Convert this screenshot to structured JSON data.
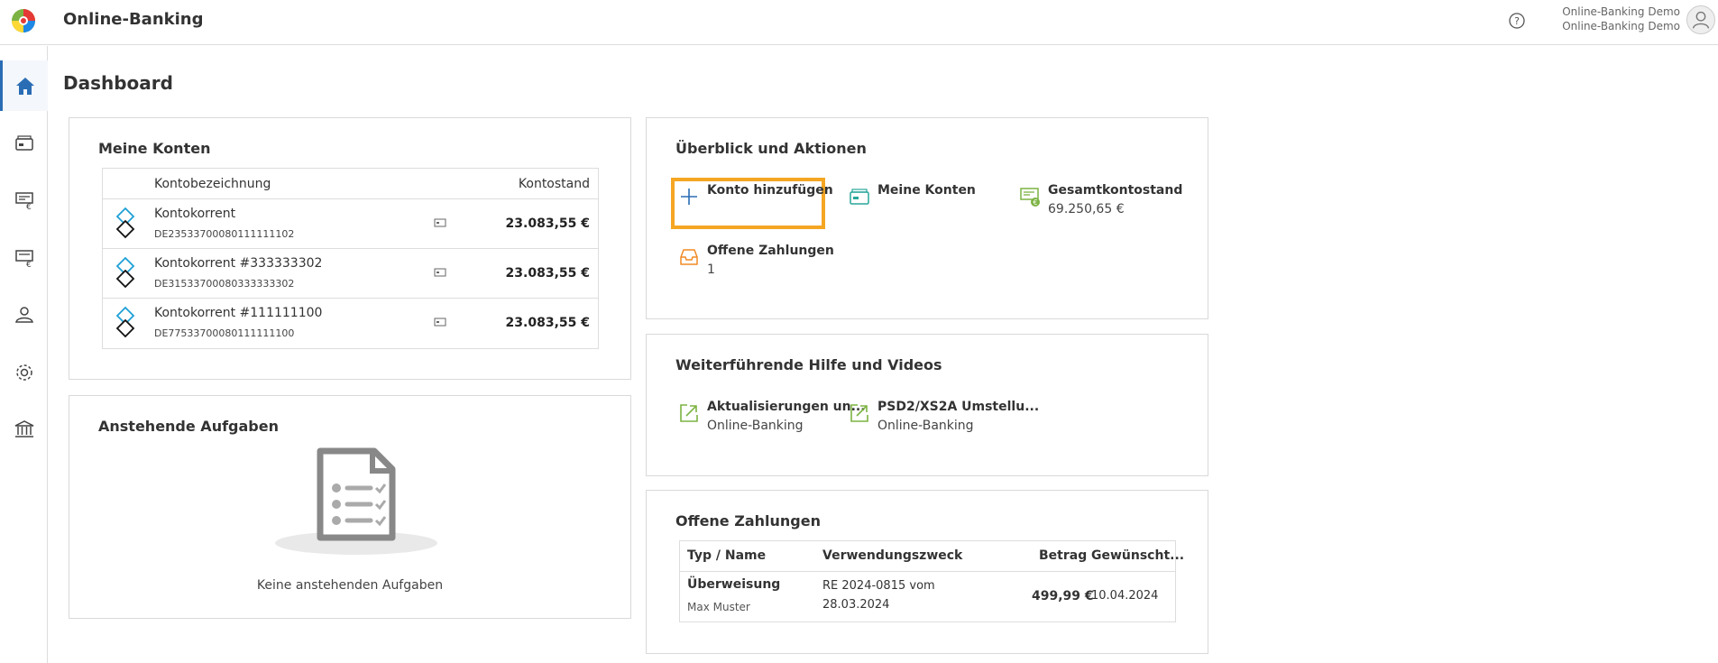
{
  "header": {
    "app_title": "Online-Banking",
    "user_line1": "Online-Banking Demo",
    "user_line2": "Online-Banking Demo"
  },
  "sidebar": {
    "items": [
      {
        "icon": "home-icon",
        "active": true
      },
      {
        "icon": "wallet-icon"
      },
      {
        "icon": "payment-transfer-icon"
      },
      {
        "icon": "payment-euro-icon"
      },
      {
        "icon": "person-icon"
      },
      {
        "icon": "gear-icon"
      },
      {
        "icon": "bank-icon"
      }
    ]
  },
  "page": {
    "title": "Dashboard"
  },
  "accounts": {
    "title": "Meine Konten",
    "columns": [
      "Kontobezeichnung",
      "Kontostand"
    ],
    "rows": [
      {
        "name": "Kontokorrent",
        "iban": "DE23533700080111111102",
        "balance": "23.083,55 €"
      },
      {
        "name": "Kontokorrent #333333302",
        "iban": "DE31533700080333333302",
        "balance": "23.083,55 €"
      },
      {
        "name": "Kontokorrent #111111100",
        "iban": "DE77533700080111111100",
        "balance": "23.083,55 €"
      }
    ]
  },
  "tasks": {
    "title": "Anstehende Aufgaben",
    "empty_text": "Keine anstehenden Aufgaben"
  },
  "overview": {
    "title": "Überblick und Aktionen",
    "actions": [
      {
        "label": "Konto hinzufügen",
        "sub": "",
        "icon": "plus-icon"
      },
      {
        "label": "Meine Konten",
        "sub": "",
        "icon": "wallet-icon"
      },
      {
        "label": "Gesamtkontostand",
        "sub": "69.250,65 €",
        "icon": "euro-document-icon"
      },
      {
        "label": "Offene Zahlungen",
        "sub": "1",
        "icon": "inbox-icon"
      }
    ]
  },
  "help": {
    "title": "Weiterführende Hilfe und Videos",
    "links": [
      {
        "label": "Aktualisierungen un...",
        "sub": "Online-Banking",
        "icon": "external-link-icon"
      },
      {
        "label": "PSD2/XS2A Umstellu...",
        "sub": "Online-Banking",
        "icon": "external-link-icon"
      }
    ]
  },
  "payments": {
    "title": "Offene Zahlungen",
    "columns": [
      "Typ / Name",
      "Verwendungszweck",
      "Betrag",
      "Gewünscht..."
    ],
    "rows": [
      {
        "type": "Überweisung",
        "name": "Max Muster",
        "purpose_line1": "RE 2024-0815 vom",
        "purpose_line2": "28.03.2024",
        "amount": "499,99 €",
        "date": "10.04.2024"
      }
    ]
  },
  "colors": {
    "accent_blue": "#2a6db5",
    "focus_orange": "#f5a623",
    "green": "#7cb342",
    "teal": "#26a69a",
    "orange": "#f08a24"
  }
}
